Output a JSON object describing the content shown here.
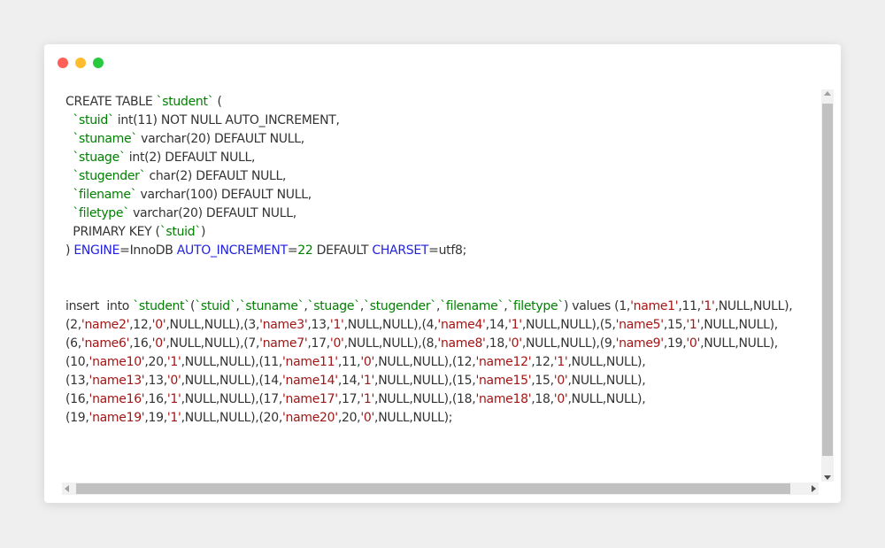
{
  "window": {
    "controls": [
      "close",
      "minimize",
      "maximize"
    ],
    "colors": {
      "close": "#ff5f56",
      "minimize": "#ffbd2e",
      "maximize": "#27c93f"
    }
  },
  "syntax_colors": {
    "default": "#333333",
    "identifier": "#008000",
    "keyword": "#2222dd",
    "string": "#a31515"
  },
  "code_lines": [
    [
      [
        "d",
        "CREATE TABLE "
      ],
      [
        "g",
        "`student`"
      ],
      [
        "d",
        " ("
      ]
    ],
    [
      [
        "d",
        "  "
      ],
      [
        "g",
        "`stuid`"
      ],
      [
        "d",
        " int(11) NOT NULL AUTO_INCREMENT,"
      ]
    ],
    [
      [
        "d",
        "  "
      ],
      [
        "g",
        "`stuname`"
      ],
      [
        "d",
        " varchar(20) DEFAULT NULL,"
      ]
    ],
    [
      [
        "d",
        "  "
      ],
      [
        "g",
        "`stuage`"
      ],
      [
        "d",
        " int(2) DEFAULT NULL,"
      ]
    ],
    [
      [
        "d",
        "  "
      ],
      [
        "g",
        "`stugender`"
      ],
      [
        "d",
        " char(2) DEFAULT NULL,"
      ]
    ],
    [
      [
        "d",
        "  "
      ],
      [
        "g",
        "`filename`"
      ],
      [
        "d",
        " varchar(100) DEFAULT NULL,"
      ]
    ],
    [
      [
        "d",
        "  "
      ],
      [
        "g",
        "`filetype`"
      ],
      [
        "d",
        " varchar(20) DEFAULT NULL,"
      ]
    ],
    [
      [
        "d",
        "  PRIMARY KEY ("
      ],
      [
        "g",
        "`stuid`"
      ],
      [
        "d",
        ")"
      ]
    ],
    [
      [
        "d",
        ") "
      ],
      [
        "b",
        "ENGINE"
      ],
      [
        "d",
        "=InnoDB "
      ],
      [
        "b",
        "AUTO_INCREMENT"
      ],
      [
        "d",
        "="
      ],
      [
        "g",
        "22"
      ],
      [
        "d",
        " DEFAULT "
      ],
      [
        "b",
        "CHARSET"
      ],
      [
        "d",
        "=utf8;"
      ]
    ],
    [],
    [],
    [
      [
        "d",
        "insert  into "
      ],
      [
        "g",
        "`student`"
      ],
      [
        "d",
        "("
      ],
      [
        "g",
        "`stuid`"
      ],
      [
        "d",
        ","
      ],
      [
        "g",
        "`stuname`"
      ],
      [
        "d",
        ","
      ],
      [
        "g",
        "`stuage`"
      ],
      [
        "d",
        ","
      ],
      [
        "g",
        "`stugender`"
      ],
      [
        "d",
        ","
      ],
      [
        "g",
        "`filename`"
      ],
      [
        "d",
        ","
      ],
      [
        "g",
        "`filetype`"
      ],
      [
        "d",
        ") values (1,"
      ],
      [
        "r",
        "'name1'"
      ],
      [
        "d",
        ",11,"
      ],
      [
        "r",
        "'1'"
      ],
      [
        "d",
        ",NULL,NULL),"
      ]
    ],
    [
      [
        "d",
        "(2,"
      ],
      [
        "r",
        "'name2'"
      ],
      [
        "d",
        ",12,"
      ],
      [
        "r",
        "'0'"
      ],
      [
        "d",
        ",NULL,NULL),(3,"
      ],
      [
        "r",
        "'name3'"
      ],
      [
        "d",
        ",13,"
      ],
      [
        "r",
        "'1'"
      ],
      [
        "d",
        ",NULL,NULL),(4,"
      ],
      [
        "r",
        "'name4'"
      ],
      [
        "d",
        ",14,"
      ],
      [
        "r",
        "'1'"
      ],
      [
        "d",
        ",NULL,NULL),(5,"
      ],
      [
        "r",
        "'name5'"
      ],
      [
        "d",
        ",15,"
      ],
      [
        "r",
        "'1'"
      ],
      [
        "d",
        ",NULL,NULL),"
      ]
    ],
    [
      [
        "d",
        "(6,"
      ],
      [
        "r",
        "'name6'"
      ],
      [
        "d",
        ",16,"
      ],
      [
        "r",
        "'0'"
      ],
      [
        "d",
        ",NULL,NULL),(7,"
      ],
      [
        "r",
        "'name7'"
      ],
      [
        "d",
        ",17,"
      ],
      [
        "r",
        "'0'"
      ],
      [
        "d",
        ",NULL,NULL),(8,"
      ],
      [
        "r",
        "'name8'"
      ],
      [
        "d",
        ",18,"
      ],
      [
        "r",
        "'0'"
      ],
      [
        "d",
        ",NULL,NULL),(9,"
      ],
      [
        "r",
        "'name9'"
      ],
      [
        "d",
        ",19,"
      ],
      [
        "r",
        "'0'"
      ],
      [
        "d",
        ",NULL,NULL),"
      ]
    ],
    [
      [
        "d",
        "(10,"
      ],
      [
        "r",
        "'name10'"
      ],
      [
        "d",
        ",20,"
      ],
      [
        "r",
        "'1'"
      ],
      [
        "d",
        ",NULL,NULL),(11,"
      ],
      [
        "r",
        "'name11'"
      ],
      [
        "d",
        ",11,"
      ],
      [
        "r",
        "'0'"
      ],
      [
        "d",
        ",NULL,NULL),(12,"
      ],
      [
        "r",
        "'name12'"
      ],
      [
        "d",
        ",12,"
      ],
      [
        "r",
        "'1'"
      ],
      [
        "d",
        ",NULL,NULL),"
      ]
    ],
    [
      [
        "d",
        "(13,"
      ],
      [
        "r",
        "'name13'"
      ],
      [
        "d",
        ",13,"
      ],
      [
        "r",
        "'0'"
      ],
      [
        "d",
        ",NULL,NULL),(14,"
      ],
      [
        "r",
        "'name14'"
      ],
      [
        "d",
        ",14,"
      ],
      [
        "r",
        "'1'"
      ],
      [
        "d",
        ",NULL,NULL),(15,"
      ],
      [
        "r",
        "'name15'"
      ],
      [
        "d",
        ",15,"
      ],
      [
        "r",
        "'0'"
      ],
      [
        "d",
        ",NULL,NULL),"
      ]
    ],
    [
      [
        "d",
        "(16,"
      ],
      [
        "r",
        "'name16'"
      ],
      [
        "d",
        ",16,"
      ],
      [
        "r",
        "'1'"
      ],
      [
        "d",
        ",NULL,NULL),(17,"
      ],
      [
        "r",
        "'name17'"
      ],
      [
        "d",
        ",17,"
      ],
      [
        "r",
        "'1'"
      ],
      [
        "d",
        ",NULL,NULL),(18,"
      ],
      [
        "r",
        "'name18'"
      ],
      [
        "d",
        ",18,"
      ],
      [
        "r",
        "'0'"
      ],
      [
        "d",
        ",NULL,NULL),"
      ]
    ],
    [
      [
        "d",
        "(19,"
      ],
      [
        "r",
        "'name19'"
      ],
      [
        "d",
        ",19,"
      ],
      [
        "r",
        "'1'"
      ],
      [
        "d",
        ",NULL,NULL),(20,"
      ],
      [
        "r",
        "'name20'"
      ],
      [
        "d",
        ",20,"
      ],
      [
        "r",
        "'0'"
      ],
      [
        "d",
        ",NULL,NULL);"
      ]
    ]
  ],
  "scrollbars": {
    "vertical_icons": [
      "scroll-up-arrow",
      "scroll-down-arrow"
    ],
    "horizontal_icons": [
      "scroll-left-arrow",
      "scroll-right-arrow"
    ]
  }
}
